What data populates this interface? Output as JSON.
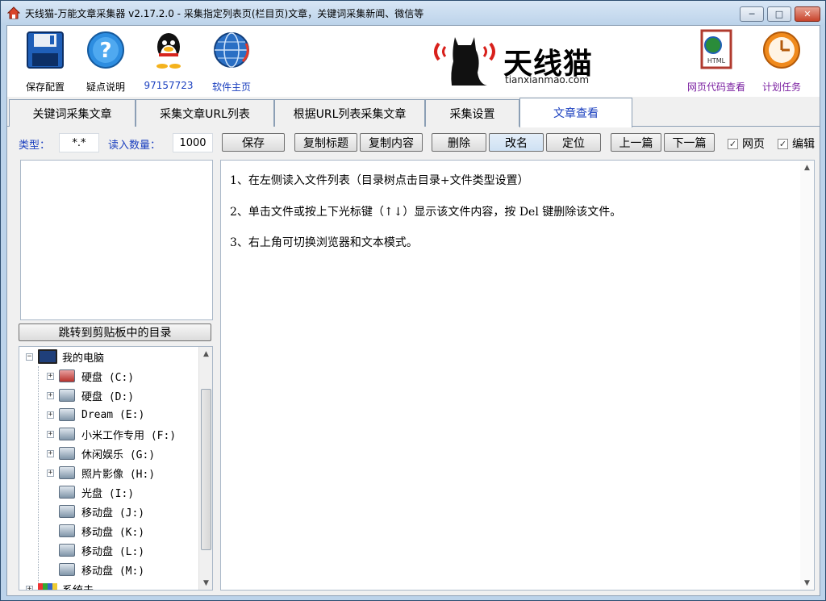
{
  "window": {
    "title": "天线猫-万能文章采集器 v2.17.2.0 - 采集指定列表页(栏目页)文章，关键词采集新闻、微信等",
    "minimize": "─",
    "maximize": "□",
    "close": "✕"
  },
  "toolbar": {
    "items": [
      {
        "label": "保存配置",
        "icon": "floppy-disk-icon"
      },
      {
        "label": "疑点说明",
        "icon": "help-question-icon"
      },
      {
        "label": "97157723",
        "icon": "qq-penguin-icon"
      },
      {
        "label": "软件主页",
        "icon": "globe-icon"
      }
    ],
    "right_items": [
      {
        "label": "网页代码查看",
        "icon": "html-document-icon"
      },
      {
        "label": "计划任务",
        "icon": "clock-icon"
      }
    ],
    "logo": {
      "text": "天线猫",
      "subtext": "tianxianmao.com"
    }
  },
  "tabs": [
    {
      "label": "关键词采集文章"
    },
    {
      "label": "采集文章URL列表"
    },
    {
      "label": "根据URL列表采集文章"
    },
    {
      "label": "采集设置"
    },
    {
      "label": "文章查看"
    }
  ],
  "options": {
    "type_label": "类型：",
    "type_value": "*.*",
    "count_label": "读入数量：",
    "count_value": "1000",
    "buttons": {
      "save": "保存",
      "copy_title": "复制标题",
      "copy_content": "复制内容",
      "delete": "删除",
      "rename": "改名",
      "locate": "定位",
      "prev": "上一篇",
      "next": "下一篇"
    },
    "checkboxes": {
      "webpage": "网页",
      "edit": "编辑"
    }
  },
  "left": {
    "jump_button": "跳转到剪贴板中的目录",
    "tree": {
      "root": "我的电脑",
      "drives": [
        {
          "label": "硬盘 (C:)",
          "expandable": true
        },
        {
          "label": "硬盘 (D:)",
          "expandable": true
        },
        {
          "label": "Dream (E:)",
          "expandable": true
        },
        {
          "label": "小米工作专用 (F:)",
          "expandable": true
        },
        {
          "label": "休闲娱乐 (G:)",
          "expandable": true
        },
        {
          "label": "照片影像 (H:)",
          "expandable": true
        },
        {
          "label": "光盘 (I:)",
          "expandable": false
        },
        {
          "label": "移动盘 (J:)",
          "expandable": false
        },
        {
          "label": "移动盘 (K:)",
          "expandable": false
        },
        {
          "label": "移动盘 (L:)",
          "expandable": false
        },
        {
          "label": "移动盘 (M:)",
          "expandable": false
        }
      ],
      "last": "系统未"
    }
  },
  "content": {
    "lines": [
      "1、在左侧读入文件列表（目录树点击目录+文件类型设置）",
      "2、单击文件或按上下光标键（↑↓）显示该文件内容，按 Del 键删除该文件。",
      "3、右上角可切换浏览器和文本模式。"
    ]
  }
}
